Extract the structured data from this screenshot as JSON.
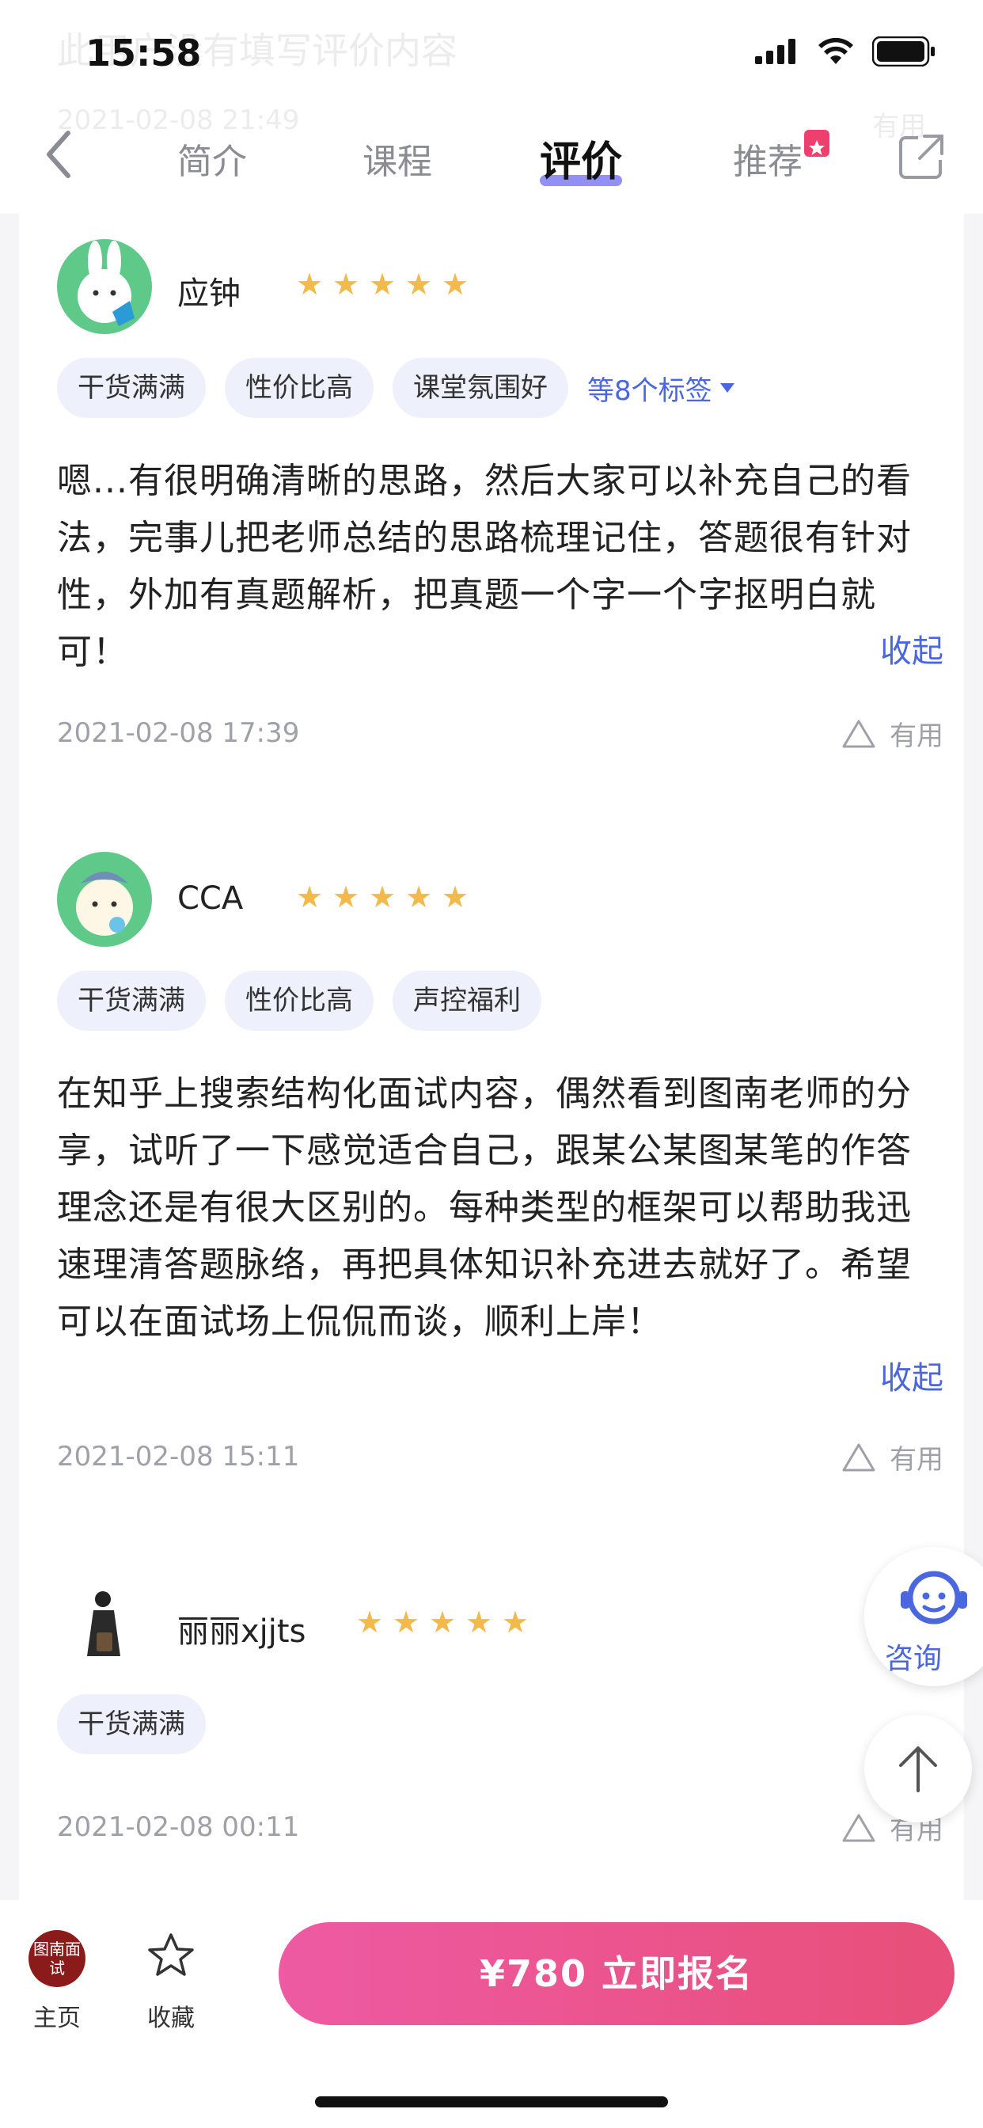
{
  "status_bar": {
    "time": "15:58"
  },
  "behind_text": {
    "line1": "此用户没有填写评价内容",
    "line2": "2021-02-08 21:49",
    "line3": "有用"
  },
  "nav": {
    "tabs": [
      {
        "label": "简介"
      },
      {
        "label": "课程"
      },
      {
        "label": "评价"
      },
      {
        "label": "推荐"
      }
    ],
    "active_tab": "评价"
  },
  "reviews": [
    {
      "user": "应钟",
      "rating": 5,
      "tags": [
        "干货满满",
        "性价比高",
        "课堂氛围好"
      ],
      "more_tags": "等8个标签",
      "text": "嗯...有很明确清晰的思路，然后大家可以补充自己的看法，完事儿把老师总结的思路梳理记住，答题很有针对性，外加有真题解析，把真题一个字一个字抠明白就可！",
      "collapse": "收起",
      "date": "2021-02-08 17:39",
      "useful": "有用"
    },
    {
      "user": "CCA",
      "rating": 5,
      "tags": [
        "干货满满",
        "性价比高",
        "声控福利"
      ],
      "text": "在知乎上搜索结构化面试内容，偶然看到图南老师的分享，试听了一下感觉适合自己，跟某公某图某笔的作答理念还是有很大区别的。每种类型的框架可以帮助我迅速理清答题脉络，再把具体知识补充进去就好了。希望可以在面试场上侃侃而谈，顺利上岸！",
      "collapse": "收起",
      "date": "2021-02-08 15:11",
      "useful": "有用"
    },
    {
      "user": "丽丽xjjts",
      "rating": 5,
      "tags": [
        "干货满满"
      ],
      "date": "2021-02-08 00:11",
      "useful": "有用"
    }
  ],
  "floating": {
    "consult_label": "咨询"
  },
  "bottom_bar": {
    "home_logo_text": "图南面试",
    "home_label": "主页",
    "fav_label": "收藏",
    "cta_label": "¥780 立即报名"
  },
  "colors": {
    "accent": "#4a67e0",
    "star": "#f2b94d",
    "cta_start": "#ee5aa3",
    "cta_end": "#e84f79",
    "tag_bg": "#eef0fb"
  }
}
